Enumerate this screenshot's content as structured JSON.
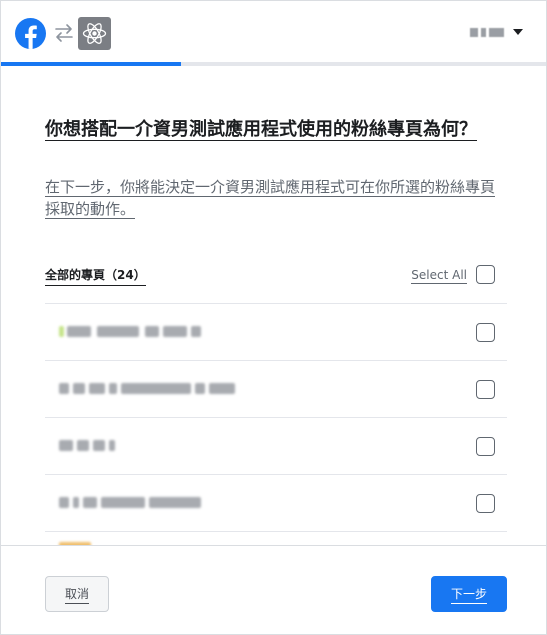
{
  "colors": {
    "accent": "#1877f2",
    "text_primary": "#1c1e21",
    "text_secondary": "#606770",
    "divider": "#e4e6eb"
  },
  "header": {
    "brand_icon": "facebook-logo-icon",
    "swap_icon": "swap-arrows-icon",
    "app_icon": "atom-app-icon",
    "account_menu_icon": "chevron-down-icon"
  },
  "progress": {
    "fraction": 0.33
  },
  "main": {
    "title": "你想搭配一介資男測試應用程式使用的粉絲專頁為何？",
    "subtitle": "在下一步，你將能決定一介資男測試應用程式可在你所選的粉絲專頁採取的動作。",
    "list_header": {
      "all_pages_label": "全部的專頁（24）",
      "select_all_label": "Select All"
    }
  },
  "footer": {
    "cancel_label": "取消",
    "next_label": "下一步"
  }
}
